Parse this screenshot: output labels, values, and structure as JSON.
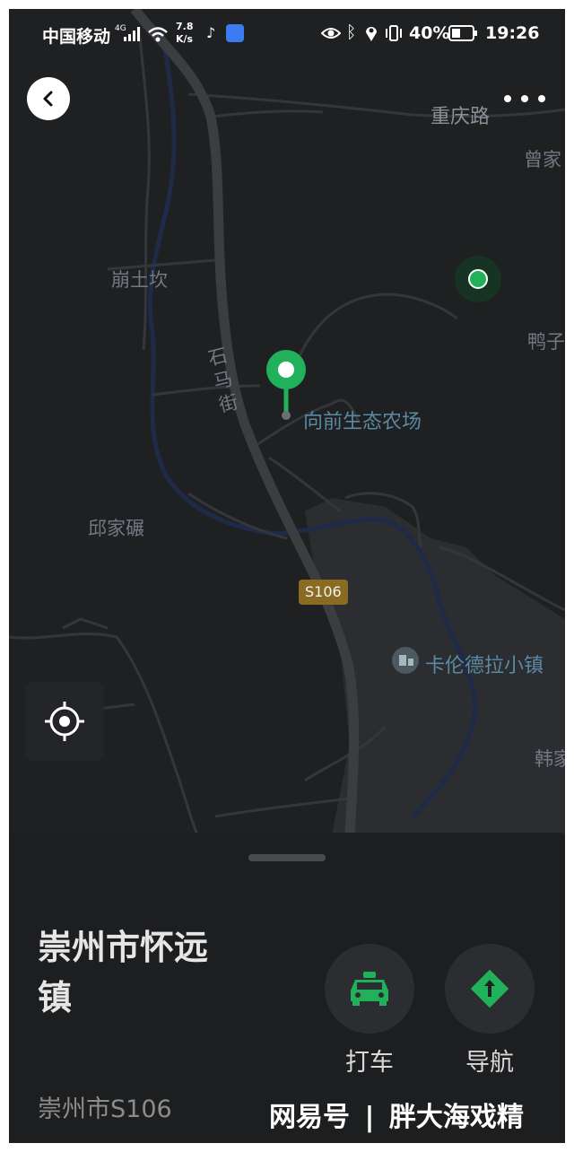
{
  "status_bar": {
    "carrier": "中国移动",
    "network_type": "4G",
    "speed_value": "7.8",
    "speed_unit": "K/s",
    "battery": "40%",
    "time": "19:26"
  },
  "map": {
    "labels": {
      "road_chongqing": "重庆路",
      "place_zengjia": "曾家",
      "place_bengtukan": "崩土坎",
      "place_yazi": "鸭子",
      "street_shima": [
        "石",
        "马",
        "街"
      ],
      "poi_farm": "向前生态农场",
      "place_qiujianian": "邱家碾",
      "road_badge": "S106",
      "poi_kalunde": "卡伦德拉小镇",
      "place_hanjia": "韩家"
    },
    "colors": {
      "background": "#1f2022",
      "road": "#3c3d41",
      "river": "#1e2a48",
      "pin": "#21b15a",
      "road_badge_bg": "#8a6b22"
    }
  },
  "panel": {
    "title_line1": "崇州市怀远",
    "title_line2": "镇",
    "subtitle": "崇州市S106",
    "taxi_label": "打车",
    "navigate_label": "导航",
    "accent_color": "#21b15a"
  },
  "watermark": {
    "brand": "网易号",
    "author": "胖大海戏精"
  }
}
